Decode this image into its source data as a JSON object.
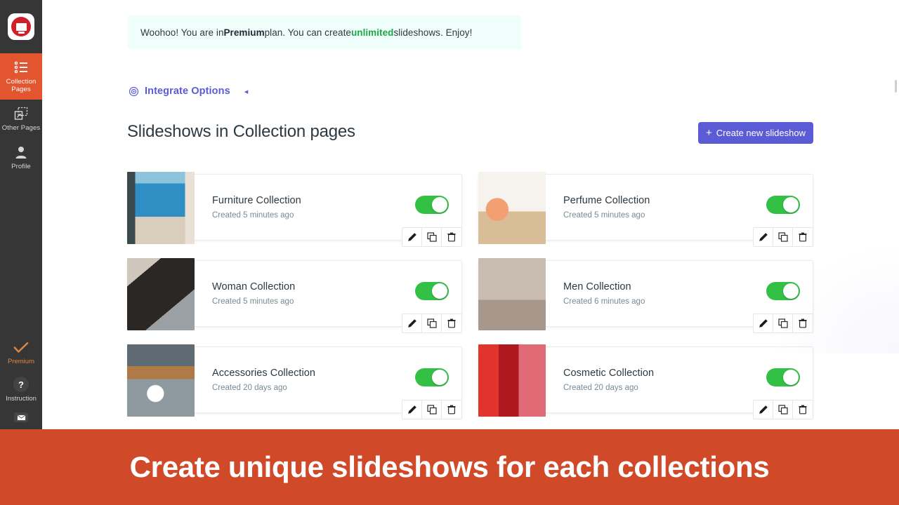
{
  "sidebar": {
    "logo_name": "slideshow-app-logo",
    "items": [
      {
        "label": "Collection Pages",
        "icon": "list-icon",
        "active": true
      },
      {
        "label": "Other Pages",
        "icon": "pages-icon",
        "active": false
      },
      {
        "label": "Profile",
        "icon": "profile-icon",
        "active": false
      }
    ],
    "premium": {
      "label": "Premium",
      "icon": "check-icon",
      "color": "#e2873f"
    },
    "instruction": {
      "label": "Instruction",
      "icon": "question-icon"
    },
    "mail": {
      "icon": "envelope-icon"
    },
    "background": "#373636",
    "active_color": "#e2552f"
  },
  "notice": {
    "prefix": "Woohoo! You are in ",
    "plan": "Premium",
    "middle": " plan. You can create ",
    "highlight": "unlimited",
    "suffix": " slideshows. Enjoy!",
    "background": "#effdfb",
    "highlight_color": "#1aa94a"
  },
  "integrate": {
    "label": "Integrate Options",
    "icon": "gear-icon",
    "caret": "◂",
    "color": "#5b5bd6"
  },
  "header": {
    "title": "Slideshows in Collection pages",
    "create_button": {
      "label": "Create new slideshow",
      "plus": "+",
      "color": "#5b5bd6"
    }
  },
  "cards": [
    {
      "title": "Furniture Collection",
      "subtitle": "Created 5 minutes ago",
      "enabled": true,
      "thumb": "furniture-thumbnail"
    },
    {
      "title": "Perfume Collection",
      "subtitle": "Created 5 minutes ago",
      "enabled": true,
      "thumb": "perfume-thumbnail"
    },
    {
      "title": "Woman Collection",
      "subtitle": "Created 5 minutes ago",
      "enabled": true,
      "thumb": "woman-thumbnail"
    },
    {
      "title": "Men Collection",
      "subtitle": "Created 6 minutes ago",
      "enabled": true,
      "thumb": "men-thumbnail"
    },
    {
      "title": "Accessories Collection",
      "subtitle": "Created 20 days ago",
      "enabled": true,
      "thumb": "accessories-thumbnail"
    },
    {
      "title": "Cosmetic Collection",
      "subtitle": "Created 20 days ago",
      "enabled": true,
      "thumb": "cosmetic-thumbnail"
    }
  ],
  "card_actions": {
    "edit": "edit-icon",
    "duplicate": "duplicate-icon",
    "delete": "delete-icon"
  },
  "toggle": {
    "on_color": "#33c145"
  },
  "bottom_banner": {
    "text": "Create unique slideshows for each collections",
    "background": "#d04a2a"
  }
}
